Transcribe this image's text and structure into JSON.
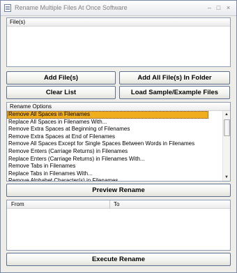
{
  "window": {
    "title": "Rename Multiple Files At Once Software",
    "minimize": "–",
    "maximize": "□",
    "close": "×"
  },
  "files_panel": {
    "header": "File(s)"
  },
  "buttons": {
    "add_files": "Add File(s)",
    "add_folder": "Add All File(s) In Folder",
    "clear_list": "Clear List",
    "load_sample": "Load Sample/Example Files",
    "preview": "Preview Rename",
    "execute": "Execute Rename"
  },
  "rename_options": {
    "header": "Rename Options",
    "items": [
      "Remove All Spaces in Filenames",
      "Replace All Spaces in Filenames With...",
      "Remove Extra Spaces at Beginning of Filenames",
      "Remove Extra Spaces at End of Filenames",
      "Remove All Spaces Except for Single Spaces Between Words in Filenames",
      "Remove Enters (Carriage Returns) in Filenames",
      "Replace Enters (Carriage Returns) in Filenames With...",
      "Remove Tabs in Filenames",
      "Replace Tabs in Filenames With...",
      "Remove Alphabet Character(s) in Filenames"
    ],
    "selected_index": 0
  },
  "results_panel": {
    "col_from": "From",
    "col_to": "To"
  },
  "scrollbar": {
    "up": "▲",
    "down": "▼"
  }
}
